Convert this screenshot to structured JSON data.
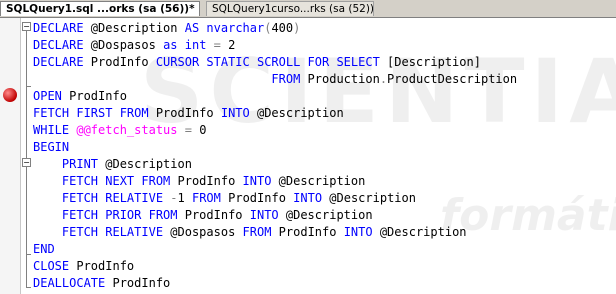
{
  "tabs": [
    {
      "label": "SQLQuery1.sql ...orks (sa (56))*",
      "active": true
    },
    {
      "label": "SQLQuery1curso...rks (sa (52))*",
      "active": false
    }
  ],
  "watermark": {
    "line1": "SCIENTIA",
    "line2": "formáticas"
  },
  "code": {
    "lines": [
      [
        {
          "t": "DECLARE",
          "c": "kw"
        },
        {
          "t": " @Description ",
          "c": "plain"
        },
        {
          "t": "AS",
          "c": "kw"
        },
        {
          "t": " ",
          "c": "plain"
        },
        {
          "t": "nvarchar",
          "c": "ty"
        },
        {
          "t": "(",
          "c": "op"
        },
        {
          "t": "400",
          "c": "num"
        },
        {
          "t": ")",
          "c": "op"
        }
      ],
      [
        {
          "t": "DECLARE",
          "c": "kw"
        },
        {
          "t": " @Dospasos ",
          "c": "plain"
        },
        {
          "t": "as",
          "c": "kw"
        },
        {
          "t": " ",
          "c": "plain"
        },
        {
          "t": "int",
          "c": "ty"
        },
        {
          "t": " ",
          "c": "plain"
        },
        {
          "t": "=",
          "c": "op"
        },
        {
          "t": " 2",
          "c": "num"
        }
      ],
      [
        {
          "t": "DECLARE",
          "c": "kw"
        },
        {
          "t": " ProdInfo ",
          "c": "plain"
        },
        {
          "t": "CURSOR STATIC SCROLL FOR SELECT",
          "c": "kw"
        },
        {
          "t": " [Description]",
          "c": "plain"
        }
      ],
      [
        {
          "t": "                                 ",
          "c": "plain"
        },
        {
          "t": "FROM",
          "c": "kw"
        },
        {
          "t": " Production",
          "c": "plain"
        },
        {
          "t": ".",
          "c": "op"
        },
        {
          "t": "ProductDescription",
          "c": "plain"
        }
      ],
      [
        {
          "t": "OPEN",
          "c": "kw"
        },
        {
          "t": " ProdInfo",
          "c": "plain"
        }
      ],
      [
        {
          "t": "FETCH FIRST FROM",
          "c": "kw"
        },
        {
          "t": " ProdInfo ",
          "c": "plain"
        },
        {
          "t": "INTO",
          "c": "kw"
        },
        {
          "t": " @Description",
          "c": "plain"
        }
      ],
      [
        {
          "t": "WHILE",
          "c": "kw"
        },
        {
          "t": " ",
          "c": "plain"
        },
        {
          "t": "@@fetch_status",
          "c": "fn"
        },
        {
          "t": " ",
          "c": "plain"
        },
        {
          "t": "=",
          "c": "op"
        },
        {
          "t": " 0",
          "c": "num"
        }
      ],
      [
        {
          "t": "BEGIN",
          "c": "kw"
        }
      ],
      [
        {
          "t": "    ",
          "c": "plain"
        },
        {
          "t": "PRINT",
          "c": "kw"
        },
        {
          "t": " @Description",
          "c": "plain"
        }
      ],
      [
        {
          "t": "    ",
          "c": "plain"
        },
        {
          "t": "FETCH NEXT FROM",
          "c": "kw"
        },
        {
          "t": " ProdInfo ",
          "c": "plain"
        },
        {
          "t": "INTO",
          "c": "kw"
        },
        {
          "t": " @Description",
          "c": "plain"
        }
      ],
      [
        {
          "t": "    ",
          "c": "plain"
        },
        {
          "t": "FETCH RELATIVE",
          "c": "kw"
        },
        {
          "t": " ",
          "c": "plain"
        },
        {
          "t": "-",
          "c": "op"
        },
        {
          "t": "1 ",
          "c": "num"
        },
        {
          "t": "FROM",
          "c": "kw"
        },
        {
          "t": " ProdInfo ",
          "c": "plain"
        },
        {
          "t": "INTO",
          "c": "kw"
        },
        {
          "t": " @Description",
          "c": "plain"
        }
      ],
      [
        {
          "t": "    ",
          "c": "plain"
        },
        {
          "t": "FETCH PRIOR FROM",
          "c": "kw"
        },
        {
          "t": " ProdInfo ",
          "c": "plain"
        },
        {
          "t": "INTO",
          "c": "kw"
        },
        {
          "t": " @Description",
          "c": "plain"
        }
      ],
      [
        {
          "t": "    ",
          "c": "plain"
        },
        {
          "t": "FETCH RELATIVE",
          "c": "kw"
        },
        {
          "t": " @Dospasos ",
          "c": "plain"
        },
        {
          "t": "FROM",
          "c": "kw"
        },
        {
          "t": " ProdInfo ",
          "c": "plain"
        },
        {
          "t": "INTO",
          "c": "kw"
        },
        {
          "t": " @Description",
          "c": "plain"
        }
      ],
      [
        {
          "t": "END",
          "c": "kw"
        }
      ],
      [
        {
          "t": "CLOSE",
          "c": "kw"
        },
        {
          "t": " ProdInfo",
          "c": "plain"
        }
      ],
      [
        {
          "t": "DEALLOCATE",
          "c": "kw"
        },
        {
          "t": " ProdInfo",
          "c": "plain"
        }
      ]
    ]
  }
}
